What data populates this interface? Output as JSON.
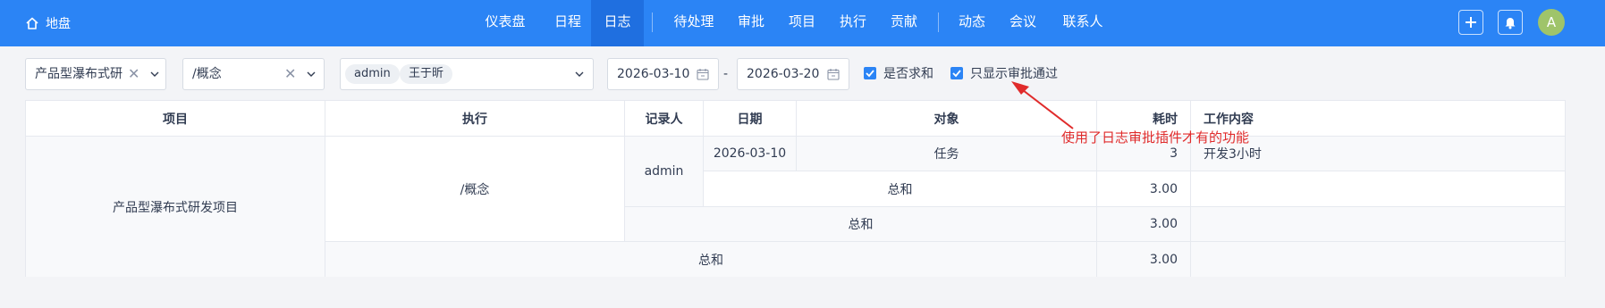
{
  "header": {
    "brand": "地盘",
    "nav": [
      {
        "label": "仪表盘"
      },
      {
        "label": "日程"
      },
      {
        "label": "日志"
      },
      {
        "label": "待处理"
      },
      {
        "label": "审批"
      },
      {
        "label": "项目"
      },
      {
        "label": "执行"
      },
      {
        "label": "贡献"
      },
      {
        "label": "动态"
      },
      {
        "label": "会议"
      },
      {
        "label": "联系人"
      }
    ],
    "active_nav": "日志",
    "avatar_initial": "A"
  },
  "filters": {
    "project": "产品型瀑布式研",
    "execution": "/概念",
    "users": [
      "admin",
      "王于昕"
    ],
    "date_from": "2026-03-10",
    "date_separator": "-",
    "date_to": "2026-03-20",
    "sum_label": "是否求和",
    "sum_checked": true,
    "approved_only_label": "只显示审批通过",
    "approved_only_checked": true
  },
  "table": {
    "headers": {
      "project": "项目",
      "execution": "执行",
      "recorder": "记录人",
      "date": "日期",
      "object": "对象",
      "hours": "耗时",
      "content": "工作内容"
    },
    "project": "产品型瀑布式研发项目",
    "execution": "/概念",
    "recorder": "admin",
    "row": {
      "date": "2026-03-10",
      "object": "任务",
      "hours": "3",
      "content": "开发3小时"
    },
    "recorder_total_label": "总和",
    "recorder_total": "3.00",
    "execution_total_label": "总和",
    "execution_total": "3.00",
    "project_total_label": "总和",
    "project_total": "3.00"
  },
  "annotation": "使用了日志审批插件才有的功能",
  "colors": {
    "primary": "#2b84f5",
    "annotation": "#e02b2b",
    "avatar": "#9fc46a"
  }
}
